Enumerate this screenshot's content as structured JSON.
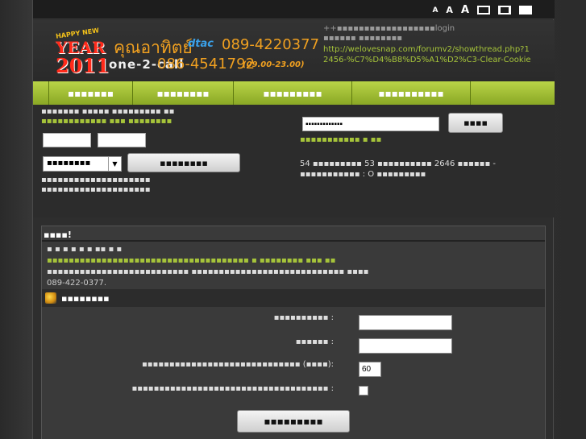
{
  "topbar": {
    "font_small": "A",
    "font_medium": "A",
    "font_large": "A"
  },
  "header": {
    "logo_happy": "HAPPY NEW",
    "logo_year": "YEAR",
    "logo_num": "2011",
    "brand": "คุณอาทิตย์",
    "dtac": "dtac",
    "phone1": "089-4220377",
    "one2call": "one-2-call",
    "phone2": "086-4541792",
    "hours": "(09.00-23.00)",
    "login_line1": "++▪▪▪▪▪▪▪▪▪▪▪▪▪▪▪▪▪▪login",
    "login_line2": "▪▪▪▪▪▪ ▪▪▪▪▪▪▪▪",
    "login_url": "http://welovesnap.com/forumv2/showthread.php?12456-%C7%D4%B8%D5%A1%D2%C3-Clear-Cookie"
  },
  "nav": {
    "items": [
      {
        "label": ""
      },
      {
        "label": "▪▪▪▪▪▪▪"
      },
      {
        "label": "▪▪▪▪▪▪▪▪"
      },
      {
        "label": "▪▪▪▪▪▪▪▪▪"
      },
      {
        "label": "▪▪▪▪▪▪▪▪▪▪"
      },
      {
        "label": ""
      }
    ]
  },
  "login_panel": {
    "line1": "▪▪▪▪▪▪▪ ▪▪▪▪▪ ▪▪▪▪▪▪▪▪▪ ▪▪",
    "line2": "▪▪▪▪▪▪▪▪▪▪▪▪ ▪▪▪ ▪▪▪▪▪▪▪▪",
    "username_value": "",
    "password_value": "",
    "select_value": "▪▪▪▪▪▪▪▪",
    "login_button": "▪▪▪▪▪▪▪▪",
    "line3": "▪▪▪▪▪▪▪▪▪▪▪▪▪▪▪▪▪▪▪▪",
    "line4": "▪▪▪▪▪▪▪▪▪▪▪▪▪▪▪▪▪▪▪▪",
    "search_value": "▪▪▪▪▪▪▪▪▪▪▪▪▪",
    "search_button": "▪▪▪▪",
    "search_hint": "▪▪▪▪▪▪▪▪▪▪▪ ▪ ▪▪",
    "stats_line1": "54 ▪▪▪▪▪▪▪▪▪   53 ▪▪▪▪▪▪▪▪▪▪   2646 ▪▪▪▪▪▪   -",
    "stats_line2": "▪▪▪▪▪▪▪▪▪▪▪ : O ▪▪▪▪▪▪▪▪▪"
  },
  "content": {
    "title": "▪▪▪▪!",
    "notice_line1": "▪ ▪ ▪ ▪ ▪ ▪ ▪▪ ▪ ▪",
    "notice_line2": "▪▪▪▪▪▪▪▪▪▪▪▪▪▪▪▪▪▪▪▪▪▪▪▪▪▪▪▪▪▪▪▪▪▪▪▪▪ ▪ ▪▪▪▪▪▪▪▪ ▪▪▪ ▪▪",
    "notice_line3": "▪▪▪▪▪▪▪▪▪▪▪▪▪▪▪▪▪▪▪▪▪▪▪▪▪▪ ▪▪▪▪▪▪▪▪▪▪▪▪▪▪▪▪▪▪▪▪▪▪▪▪▪▪▪▪ ▪▪▪▪",
    "notice_phone": "089-422-0377.",
    "section_title": "▪▪▪▪▪▪▪▪",
    "field1_label": "▪▪▪▪▪▪▪▪▪▪ :",
    "field2_label": "▪▪▪▪▪▪ :",
    "field3_label": "▪▪▪▪▪▪▪▪▪▪▪▪▪▪▪▪▪▪▪▪▪▪▪▪▪▪▪▪▪ (▪▪▪▪):",
    "field3_value": "60",
    "field4_label": "▪▪▪▪▪▪▪▪▪▪▪▪▪▪▪▪▪▪▪▪▪▪▪▪▪▪▪▪▪▪▪▪▪▪▪▪ :",
    "field1_value": "",
    "field2_value": "",
    "submit_label": "▪▪▪▪▪▪▪▪▪"
  },
  "colors": {
    "accent_green": "#a6c43a",
    "brand_orange": "#f0a020",
    "dtac_blue": "#3aa0e8"
  }
}
